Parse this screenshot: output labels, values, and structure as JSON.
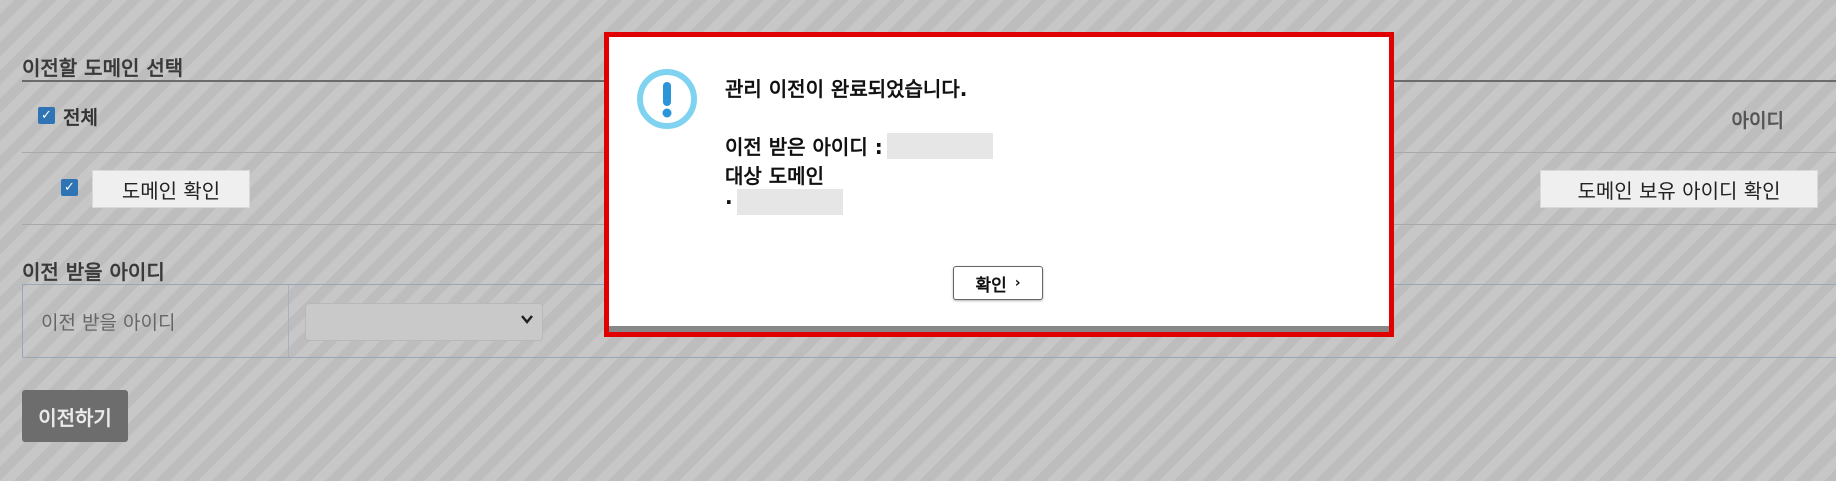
{
  "background": {
    "section_domain_title": "이전할 도메인 선택",
    "select_all_label": "전체",
    "column_id_label": "아이디",
    "check_domain_button": "도메인 확인",
    "check_owner_button": "도메인 보유 아이디 확인",
    "section_recv_title": "이전 받을 아이디",
    "recv_field_label": "이전 받을 아이디",
    "transfer_button": "이전하기"
  },
  "modal": {
    "title": "관리 이전이 완료되었습니다.",
    "recv_label": "이전 받은 아이디 :",
    "target_label": "대상 도메인",
    "bullet": "·",
    "ok_label": "확인",
    "ok_chevron": "›",
    "icon": "exclamation-circle-icon",
    "accent_color": "#7fd3f0",
    "highlight_border_color": "#e00000"
  }
}
